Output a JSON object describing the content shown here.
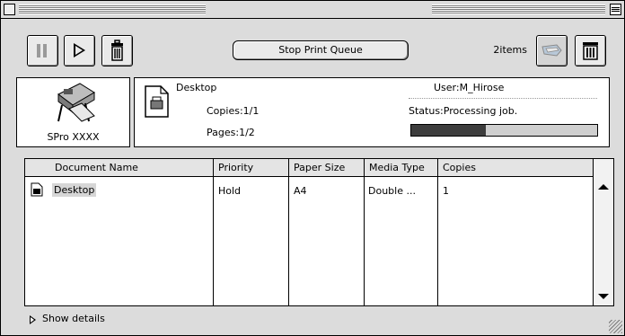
{
  "toolbar": {
    "pause_label": "",
    "play_label": "",
    "stop_queue_label": "Stop Print Queue",
    "items_count": "2items"
  },
  "printer": {
    "name": "SPro XXXX"
  },
  "job": {
    "document": "Desktop",
    "copies": "Copies:1/1",
    "pages": "Pages:1/2",
    "user": "User:M_Hirose",
    "status": "Status:Processing job.",
    "progress_fraction": 0.4
  },
  "list": {
    "columns": [
      "Document Name",
      "Priority",
      "Paper Size",
      "Media Type",
      "Copies"
    ],
    "rows": [
      {
        "document": "Desktop",
        "priority": "Hold",
        "paper_size": "A4",
        "media_type": "Double ...",
        "copies": "1"
      }
    ]
  },
  "footer": {
    "show_details_label": "Show details"
  },
  "colors": {
    "window_bg": "#dcdcdc",
    "progress_fill": "#3d3d3d",
    "selection": "#d6d6d6"
  },
  "icons": [
    "close-box-icon",
    "zoom-box-icon",
    "pause-icon",
    "play-icon",
    "trash-icon",
    "priority-icon",
    "delete-icon",
    "printer-icon",
    "document-icon",
    "disclosure-triangle-icon",
    "grow-box-icon"
  ]
}
